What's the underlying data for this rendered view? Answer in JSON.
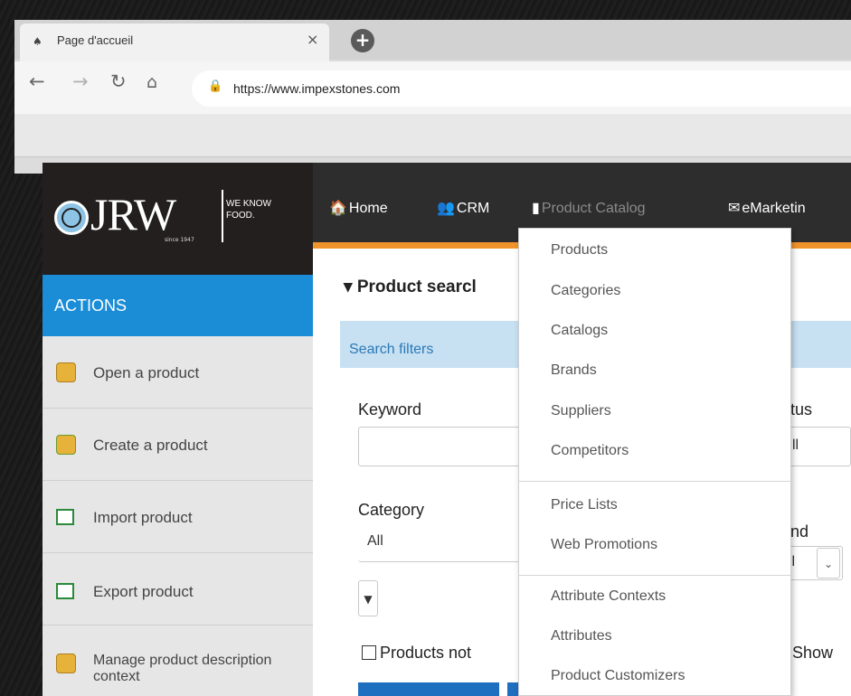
{
  "browser": {
    "tab_title": "Page d'accueil",
    "tab_close": "×",
    "new_tab": "+",
    "url": "https://www.impexstones.com"
  },
  "logo": {
    "text": "JRW",
    "tagline": "WE KNOW FOOD.",
    "since": "since 1947"
  },
  "nav": {
    "home": "Home",
    "crm": "CRM",
    "product_catalog": "Product Catalog",
    "emarketing": "eMarketin"
  },
  "content": {
    "title": "Product searcl",
    "filters_label": "Search filters",
    "keyword_label": "Keyword",
    "status_label": "tus",
    "status_value": "ll",
    "category_label": "Category",
    "category_value": "All",
    "brand_label": "nd",
    "brand_value": "ll",
    "checkbox_label": "Products not",
    "show_label": "Show"
  },
  "sidebar": {
    "header": "ACTIONS",
    "items": [
      {
        "label": "Open a product",
        "icon": "box-icon"
      },
      {
        "label": "Create a product",
        "icon": "box-add-icon"
      },
      {
        "label": "Import product",
        "icon": "excel-icon"
      },
      {
        "label": "Export product",
        "icon": "excel-icon"
      },
      {
        "label": "Manage product description context",
        "icon": "box-settings-icon"
      }
    ]
  },
  "dropdown": {
    "items": [
      "Products",
      "Categories",
      "Catalogs",
      "Brands",
      "Suppliers",
      "Competitors",
      "Price Lists",
      "Web Promotions",
      "Attribute Contexts",
      "Attributes",
      "Product Customizers"
    ]
  },
  "colors": {
    "actions_blue": "#1b8dd7",
    "accent_orange": "#f0932b",
    "topbar": "#2d2d2d",
    "filters_blue": "#c7e0f2"
  }
}
